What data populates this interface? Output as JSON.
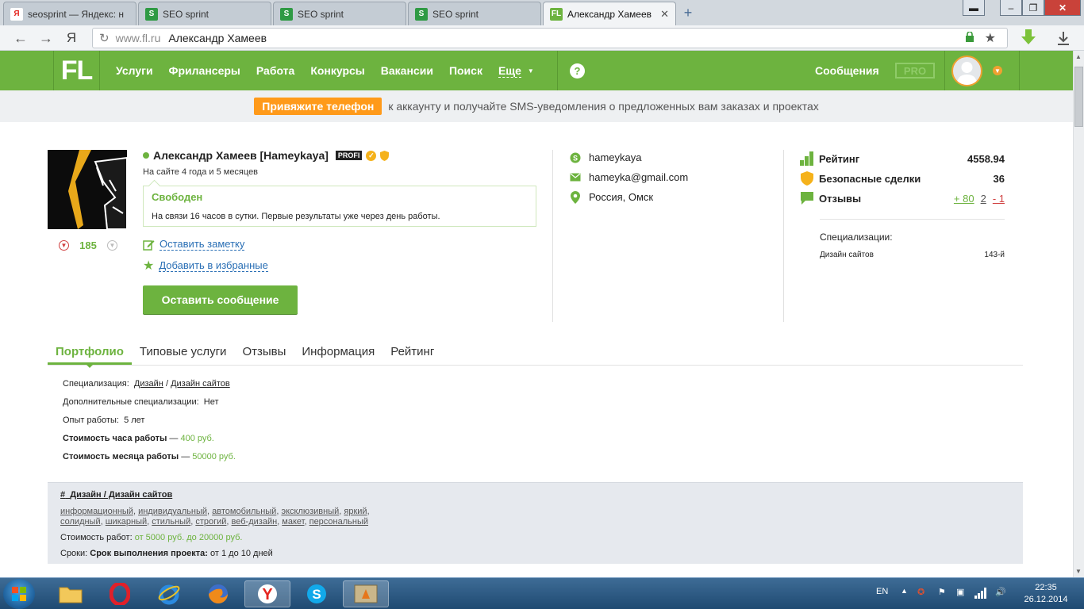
{
  "browser": {
    "tabs": [
      {
        "label": "seosprint — Яндекс: н",
        "icon": "yandex-favicon",
        "color": "#ffffff"
      },
      {
        "label": "SEO sprint",
        "icon": "seosprint-favicon",
        "color": "#2f9a44"
      },
      {
        "label": "SEO sprint",
        "icon": "seosprint-favicon",
        "color": "#2f9a44"
      },
      {
        "label": "SEO sprint",
        "icon": "seosprint-favicon",
        "color": "#2f9a44"
      },
      {
        "label": "Александр Хамеев",
        "icon": "fl-favicon",
        "color": "#6db33f"
      }
    ],
    "url_host": "www.fl.ru",
    "url_title": "Александр Хамеев"
  },
  "header": {
    "logo": "FL",
    "nav": [
      "Услуги",
      "Фрилансеры",
      "Работа",
      "Конкурсы",
      "Вакансии",
      "Поиск",
      "Еще"
    ],
    "help": "?",
    "messages": "Сообщения",
    "pro": "PRO"
  },
  "banner": {
    "button": "Привяжите телефон",
    "text": "к аккаунту и получайте SMS-уведомления о предложенных вам заказах и проектах"
  },
  "profile": {
    "name": "Александр Хамеев [Hameykaya]",
    "profi": "PROFI",
    "onsite": "На сайте 4 года и 5 месяцев",
    "status_title": "Свободен",
    "status_desc": "На связи 16 часов в сутки. Первые результаты уже через день работы.",
    "votes": "185",
    "note_link": "Оставить заметку",
    "fav_link": "Добавить в избранные",
    "send_button": "Оставить сообщение"
  },
  "contacts": {
    "skype": "hameykaya",
    "email": "hameyka@gmail.com",
    "location": "Россия, Омск"
  },
  "stats": {
    "rating_label": "Рейтинг",
    "rating_value": "4558.94",
    "deals_label": "Безопасные сделки",
    "deals_value": "36",
    "reviews_label": "Отзывы",
    "reviews_pos": "+ 80",
    "reviews_neutral": "2",
    "reviews_neg": "- 1",
    "spec_title": "Специализации:",
    "spec_name": "Дизайн сайтов",
    "spec_rank": "143-й"
  },
  "tabs": [
    "Портфолио",
    "Типовые услуги",
    "Отзывы",
    "Информация",
    "Рейтинг"
  ],
  "info": {
    "spec_label": "Специализация:",
    "spec_a": "Дизайн",
    "spec_sep": "/",
    "spec_b": "Дизайн сайтов",
    "extra_label": "Дополнительные специализации:",
    "extra_value": "Нет",
    "exp_label": "Опыт работы:",
    "exp_value": "5 лет",
    "hour_label": "Стоимость часа работы",
    "hour_value": "400 руб.",
    "month_label": "Стоимость месяца работы",
    "month_value": "50000 руб.",
    "dash": "—"
  },
  "portfolio": {
    "hash": "#",
    "title": "Дизайн / Дизайн сайтов",
    "tags": [
      "информационный",
      "индивидуальный",
      "автомобильный",
      "эксклюзивный",
      "яркий",
      "солидный",
      "шикарный",
      "стильный",
      "строгий",
      "веб-дизайн",
      "макет",
      "персональный"
    ],
    "cost_label": "Стоимость работ:",
    "cost_value": "от 5000 руб. до 20000 руб.",
    "term_label": "Сроки:",
    "term_bold": "Срок выполнения проекта:",
    "term_value": "от 1 до 10 дней"
  },
  "taskbar": {
    "lang": "EN",
    "time": "22:35",
    "date": "26.12.2014"
  }
}
